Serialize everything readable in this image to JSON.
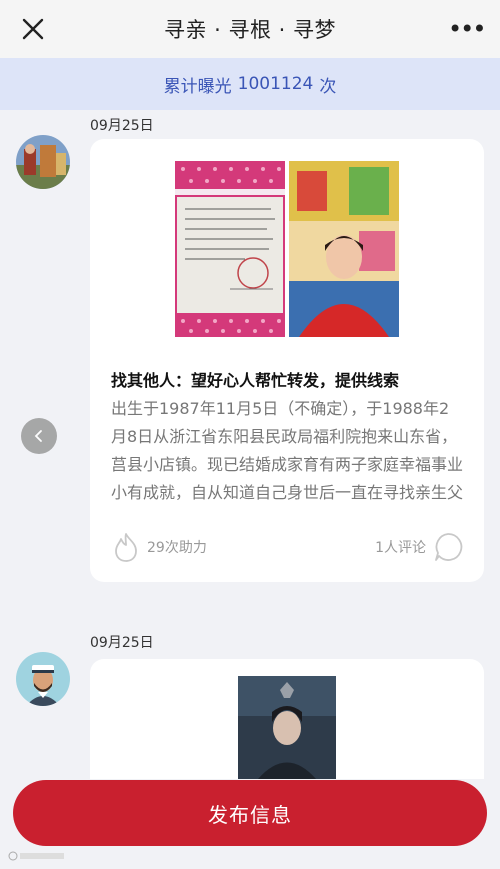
{
  "header": {
    "title": "寻亲 · 寻根 · 寻梦",
    "more_glyph": "•••"
  },
  "banner": {
    "label": "累计曝光",
    "count": "1001124",
    "unit": "次"
  },
  "feed": [
    {
      "date": "09月25日",
      "title": "找其他人：望好心人帮忙转发，提供线索",
      "body": "出生于1987年11月5日（不确定），于1988年2月8日从浙江省东阳县民政局福利院抱来山东省，莒县小店镇。现已结婚成家育有两子家庭幸福事业小有成就，自从知道自己身世后一直在寻找亲生父母",
      "assists": "29次助力",
      "comments": "1人评论"
    },
    {
      "date": "09月25日"
    }
  ],
  "publish_button": "发布信息",
  "colors": {
    "accent": "#c9202f",
    "banner_bg": "#dde4f8",
    "banner_text": "#3a55b6"
  },
  "icons": [
    "close-icon",
    "more-icon",
    "flame-icon",
    "comment-icon",
    "chevron-left-icon"
  ]
}
